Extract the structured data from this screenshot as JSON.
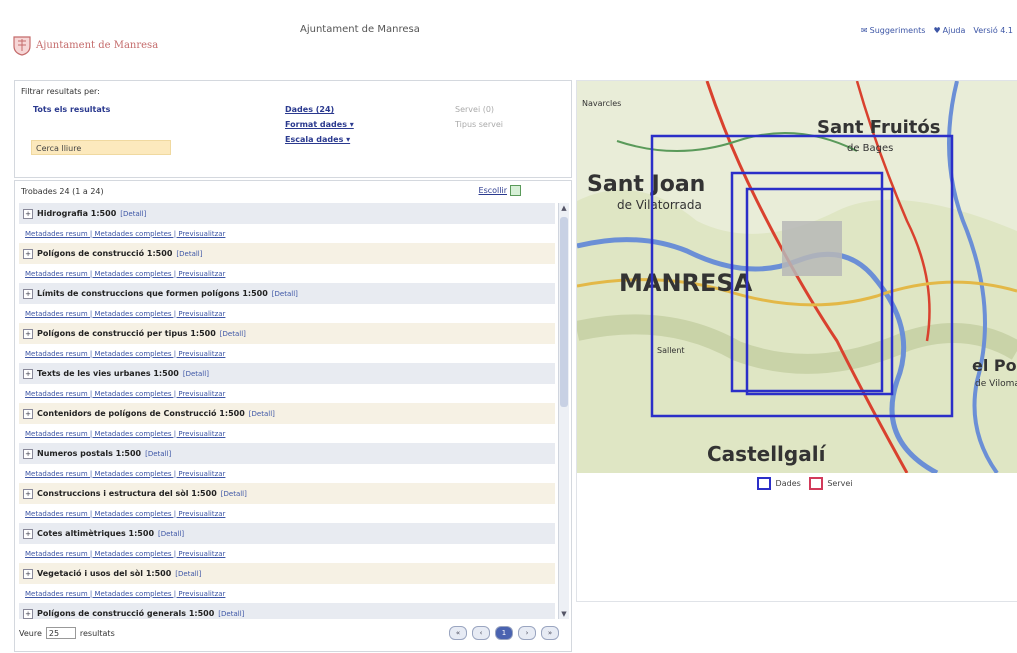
{
  "header": {
    "logo_text": "Ajuntament de Manresa",
    "title": "Ajuntament de Manresa",
    "links": [
      {
        "label": "Suggeriments",
        "icon": "mail-icon"
      },
      {
        "label": "Ajuda",
        "icon": "heart-icon"
      },
      {
        "label": "Versió 4.1"
      }
    ]
  },
  "filter": {
    "title": "Filtrar resultats per:",
    "all_results": "Tots els resultats",
    "col2": [
      "Dades (24)",
      "Format dades ▾",
      "Escala dades ▾"
    ],
    "col3": [
      "Servei (0)",
      "Tipus servei"
    ],
    "free_search": "Cerca lliure"
  },
  "results": {
    "header": "Trobades 24 (1 a 24)",
    "select_label": "Escollir",
    "detail_label": "[Detall]",
    "links_text": "Metadades resum | Metadades completes | Previsualitzar",
    "items": [
      "Hidrografia 1:500",
      "Polígons de construcció 1:500",
      "Límits de construccions que formen polígons 1:500",
      "Polígons de construcció per tipus 1:500",
      "Texts de les vies urbanes 1:500",
      "Contenidors de polígons de Construcció 1:500",
      "Numeros postals 1:500",
      "Construccions i estructura del sòl 1:500",
      "Cotes altimètriques 1:500",
      "Vegetació i usos del sòl 1:500",
      "Polígons de construcció generals 1:500"
    ],
    "per_page_prefix": "Veure",
    "per_page_value": "25",
    "per_page_suffix": "resultats",
    "pager": [
      "«",
      "‹",
      "1",
      "›",
      "»"
    ]
  },
  "map": {
    "labels": [
      "Sant Joan",
      "de Vilatorrada",
      "MANRESA",
      "Sant Fruitós",
      "de Bages",
      "Castellgalí",
      "el Pont",
      "de Vilomara",
      "Sallent",
      "Navarcles"
    ],
    "legend": [
      {
        "label": "Dades",
        "color": "#2b2fc8"
      },
      {
        "label": "Servei",
        "color": "#d23a5a"
      }
    ]
  }
}
